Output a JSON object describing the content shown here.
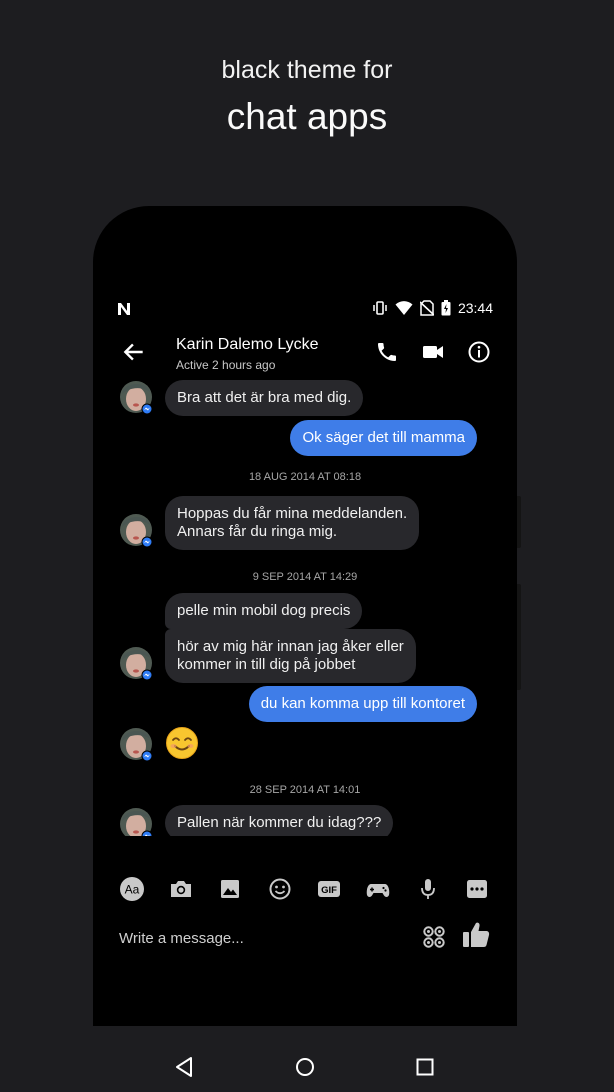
{
  "promo": {
    "line1": "black theme for",
    "line2": "chat apps"
  },
  "status_bar": {
    "time": "23:44",
    "icons": [
      "n-logo-icon",
      "vibrate-icon",
      "wifi-icon",
      "no-sim-icon",
      "battery-icon"
    ]
  },
  "header": {
    "contact_name": "Karin Dalemo Lycke",
    "contact_status": "Active 2 hours ago",
    "icons": [
      "back-arrow-icon",
      "phone-icon",
      "video-camera-icon",
      "info-icon"
    ]
  },
  "messages": [
    {
      "type": "in",
      "text": "Bra att det är bra med dig."
    },
    {
      "type": "out",
      "text": "Ok säger det till mamma"
    },
    {
      "type": "timestamp",
      "text": "18 AUG 2014 AT 08:18"
    },
    {
      "type": "in",
      "lines": [
        "Hoppas du får mina meddelanden.",
        "Annars får du ringa mig."
      ]
    },
    {
      "type": "timestamp",
      "text": "9 SEP 2014 AT 14:29"
    },
    {
      "type": "in",
      "text": "pelle min mobil dog precis"
    },
    {
      "type": "in",
      "lines": [
        "hör av mig här innan jag åker eller",
        "kommer in till dig på jobbet"
      ]
    },
    {
      "type": "out",
      "text": "du kan komma upp till kontoret"
    },
    {
      "type": "emoji",
      "icon": "smiling-face-icon"
    },
    {
      "type": "timestamp",
      "text": "28 SEP 2014 AT 14:01"
    },
    {
      "type": "in",
      "text": "Pallen när kommer du idag???"
    }
  ],
  "toolbar": {
    "aa_label": "Aa",
    "gif_label": "GIF",
    "icons": [
      "text-format-icon",
      "camera-icon",
      "image-icon",
      "emoji-icon",
      "gif-icon",
      "game-controller-icon",
      "microphone-icon",
      "more-icon"
    ]
  },
  "composer": {
    "placeholder": "Write a message...",
    "icons": [
      "qr-code-icon",
      "thumbs-up-icon"
    ]
  },
  "nav_bar": {
    "icons": [
      "back-triangle-icon",
      "home-circle-icon",
      "recents-square-icon"
    ]
  },
  "colors": {
    "background": "#1d1d20",
    "phone": "#000000",
    "incoming_bubble": "#28282c",
    "outgoing_bubble": "#3f7de8",
    "messenger_badge": "#2f7cf6"
  }
}
